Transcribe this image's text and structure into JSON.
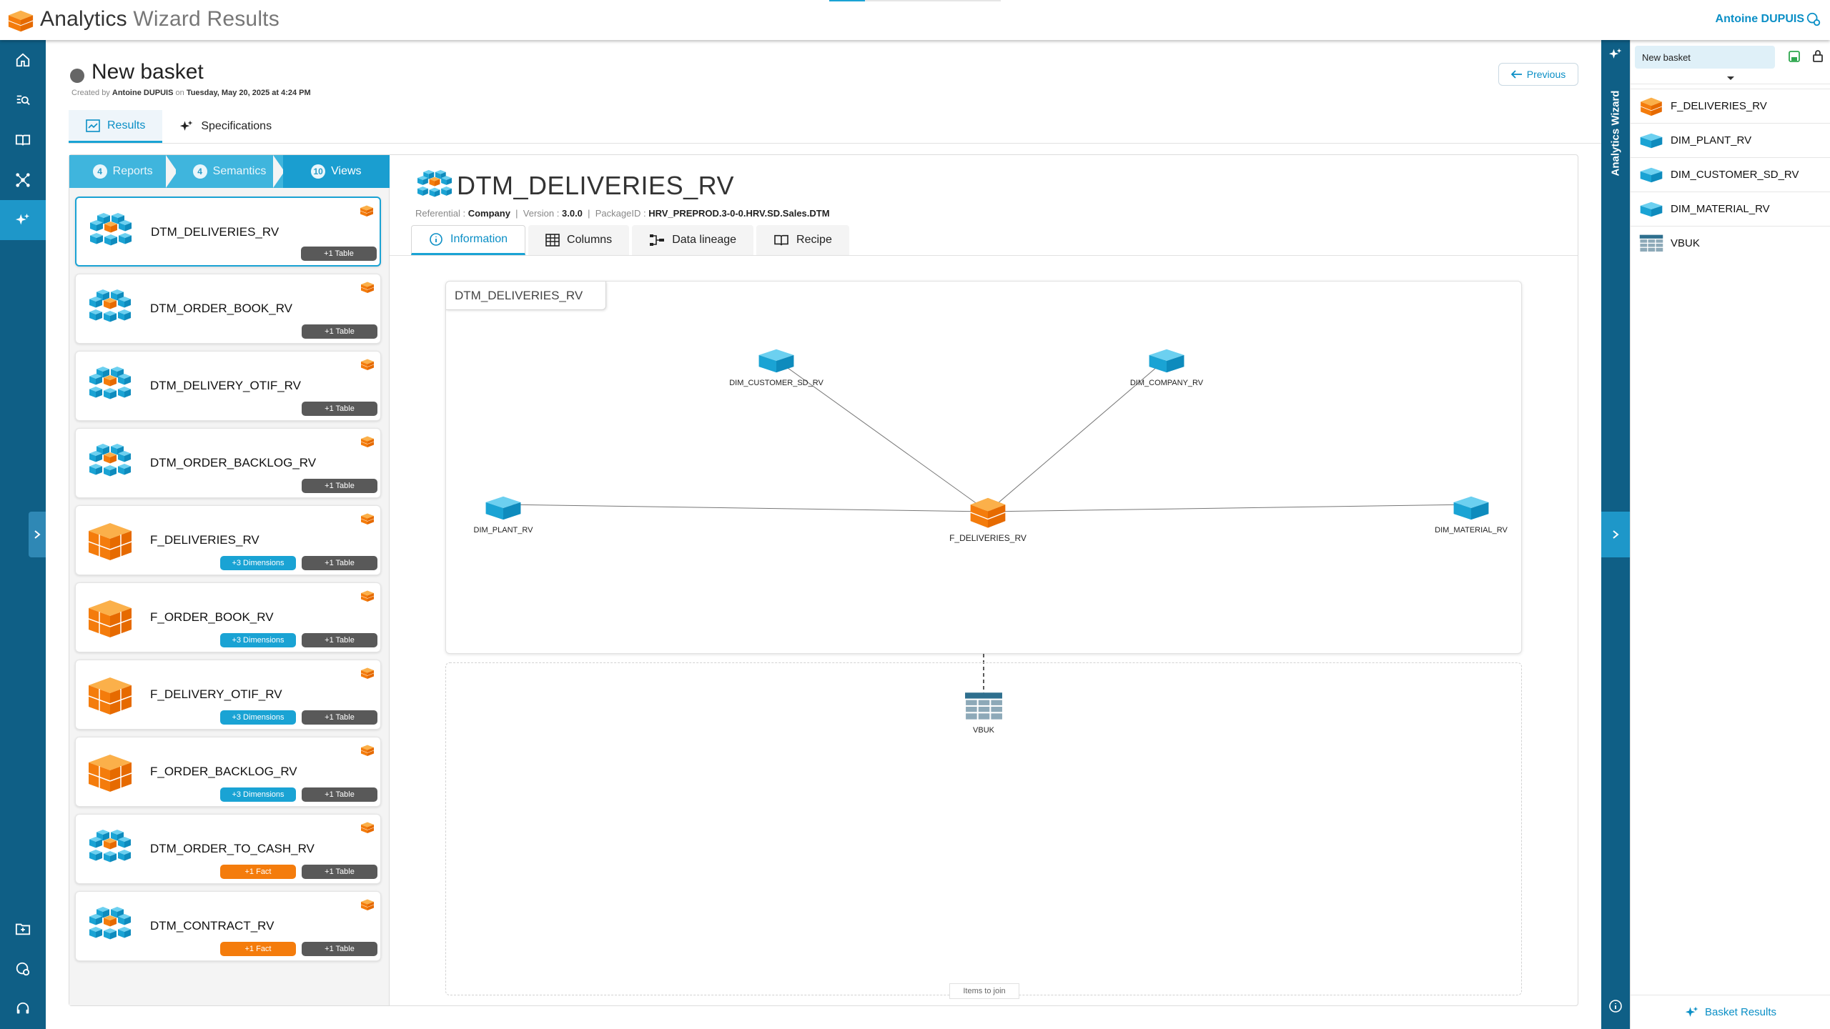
{
  "app": {
    "title_main": "Analytics",
    "title_light": "Wizard Results",
    "user": "Antoine DUPUIS"
  },
  "header": {
    "title": "New basket",
    "meta_created": "Created by",
    "meta_author": "Antoine DUPUIS",
    "meta_on": "on",
    "meta_date": "Tuesday, May 20, 2025 at 4:24 PM",
    "previous_label": "Previous"
  },
  "tabs": {
    "results": "Results",
    "specifications": "Specifications"
  },
  "steps": [
    {
      "count": "4",
      "label": "Reports"
    },
    {
      "count": "4",
      "label": "Semantics"
    },
    {
      "count": "10",
      "label": "Views"
    }
  ],
  "views": [
    {
      "name": "DTM_DELIVERIES_RV",
      "kind": "datamart",
      "badges": [
        {
          "type": "tbl",
          "label": "+1 Table"
        }
      ]
    },
    {
      "name": "DTM_ORDER_BOOK_RV",
      "kind": "datamart",
      "badges": [
        {
          "type": "tbl",
          "label": "+1 Table"
        }
      ]
    },
    {
      "name": "DTM_DELIVERY_OTIF_RV",
      "kind": "datamart",
      "badges": [
        {
          "type": "tbl",
          "label": "+1 Table"
        }
      ]
    },
    {
      "name": "DTM_ORDER_BACKLOG_RV",
      "kind": "datamart",
      "badges": [
        {
          "type": "tbl",
          "label": "+1 Table"
        }
      ]
    },
    {
      "name": "F_DELIVERIES_RV",
      "kind": "fact",
      "badges": [
        {
          "type": "dim",
          "label": "+3 Dimensions"
        },
        {
          "type": "tbl",
          "label": "+1 Table"
        }
      ]
    },
    {
      "name": "F_ORDER_BOOK_RV",
      "kind": "fact",
      "badges": [
        {
          "type": "dim",
          "label": "+3 Dimensions"
        },
        {
          "type": "tbl",
          "label": "+1 Table"
        }
      ]
    },
    {
      "name": "F_DELIVERY_OTIF_RV",
      "kind": "fact",
      "badges": [
        {
          "type": "dim",
          "label": "+3 Dimensions"
        },
        {
          "type": "tbl",
          "label": "+1 Table"
        }
      ]
    },
    {
      "name": "F_ORDER_BACKLOG_RV",
      "kind": "fact",
      "badges": [
        {
          "type": "dim",
          "label": "+3 Dimensions"
        },
        {
          "type": "tbl",
          "label": "+1 Table"
        }
      ]
    },
    {
      "name": "DTM_ORDER_TO_CASH_RV",
      "kind": "datamart",
      "badges": [
        {
          "type": "fact",
          "label": "+1 Fact"
        },
        {
          "type": "tbl",
          "label": "+1 Table"
        }
      ]
    },
    {
      "name": "DTM_CONTRACT_RV",
      "kind": "datamart",
      "badges": [
        {
          "type": "fact",
          "label": "+1 Fact"
        },
        {
          "type": "tbl",
          "label": "+1 Table"
        }
      ]
    }
  ],
  "detail": {
    "title": "DTM_DELIVERIES_RV",
    "referential_label": "Referential :",
    "referential": "Company",
    "version_label": "Version :",
    "version": "3.0.0",
    "package_label": "PackageID :",
    "package": "HRV_PREPROD.3-0-0.HRV.SD.Sales.DTM",
    "tabs": {
      "information": "Information",
      "columns": "Columns",
      "lineage": "Data lineage",
      "recipe": "Recipe"
    }
  },
  "graph": {
    "tag": "DTM_DELIVERIES_RV",
    "center": "F_DELIVERIES_RV",
    "dims": {
      "customer": "DIM_CUSTOMER_SD_RV",
      "company": "DIM_COMPANY_RV",
      "plant": "DIM_PLANT_RV",
      "material": "DIM_MATERIAL_RV"
    },
    "table": "VBUK",
    "join_label": "Items to join"
  },
  "basket": {
    "name": "New basket",
    "side_title": "Analytics Wizard",
    "items": [
      {
        "name": "F_DELIVERIES_RV",
        "kind": "fact"
      },
      {
        "name": "DIM_PLANT_RV",
        "kind": "dim"
      },
      {
        "name": "DIM_CUSTOMER_SD_RV",
        "kind": "dim"
      },
      {
        "name": "DIM_MATERIAL_RV",
        "kind": "dim"
      },
      {
        "name": "VBUK",
        "kind": "table"
      }
    ],
    "footer": "Basket Results"
  },
  "colors": {
    "accent": "#1aa3d4",
    "nav": "#0f5f86",
    "fact": "#f47c0c",
    "table_badge": "#595959"
  }
}
